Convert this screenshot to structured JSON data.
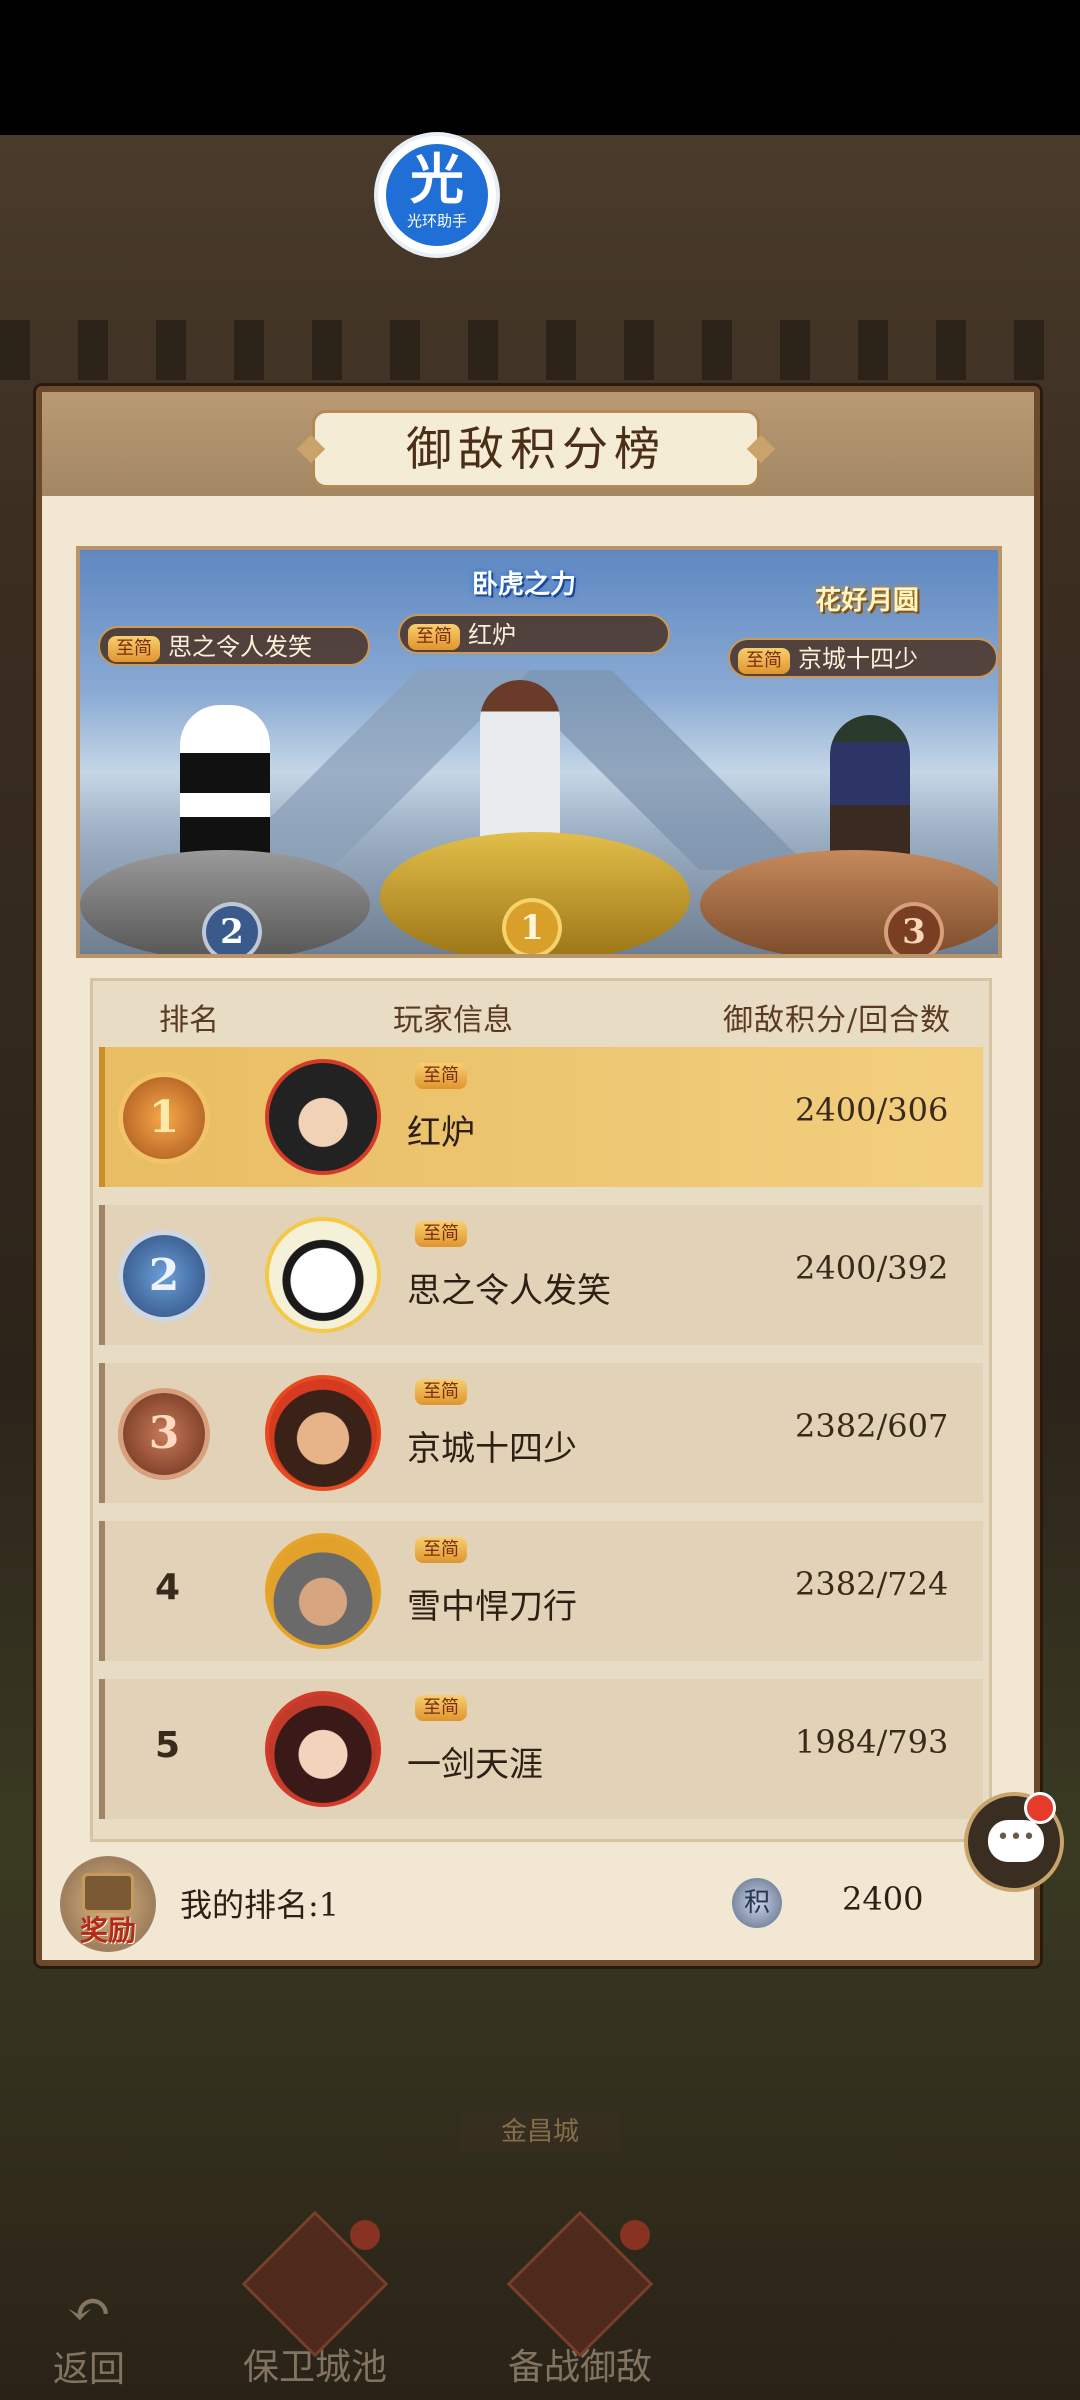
{
  "helper": {
    "glyph": "光",
    "label": "光环助手"
  },
  "panel": {
    "title": "御敌积分榜"
  },
  "podium": {
    "banner_first": "卧虎之力",
    "banner_third": "花好月圆",
    "first": {
      "tier": "至简",
      "name": "红炉",
      "rank": "1"
    },
    "second": {
      "tier": "至简",
      "name": "思之令人发笑",
      "rank": "2"
    },
    "third": {
      "tier": "至简",
      "name": "京城十四少",
      "rank": "3"
    }
  },
  "table": {
    "headers": {
      "rank": "排名",
      "info": "玩家信息",
      "score": "御敌积分/回合数"
    },
    "rows": [
      {
        "rank": "1",
        "tier": "至简",
        "name": "红炉",
        "score": "2400/306"
      },
      {
        "rank": "2",
        "tier": "至简",
        "name": "思之令人发笑",
        "score": "2400/392"
      },
      {
        "rank": "3",
        "tier": "至简",
        "name": "京城十四少",
        "score": "2382/607"
      },
      {
        "rank": "4",
        "tier": "至简",
        "name": "雪中悍刀行",
        "score": "2382/724"
      },
      {
        "rank": "5",
        "tier": "至简",
        "name": "一剑天涯",
        "score": "1984/793"
      }
    ]
  },
  "my_rank": {
    "reward_label": "奖励",
    "text": "我的排名:1",
    "score_icon": "积",
    "score": "2400"
  },
  "city_sign": "金昌城",
  "bottom_nav": {
    "back": "返回",
    "defend": "保卫城池",
    "prepare": "备战御敌"
  },
  "icons": {
    "chat": "chat-icon",
    "back": "back-arrow-icon",
    "reward": "treasure-chest-icon"
  },
  "colors": {
    "accent_gold": "#e8bd63",
    "badge_red": "#e63a2a",
    "helper_blue": "#1f6fd6"
  }
}
